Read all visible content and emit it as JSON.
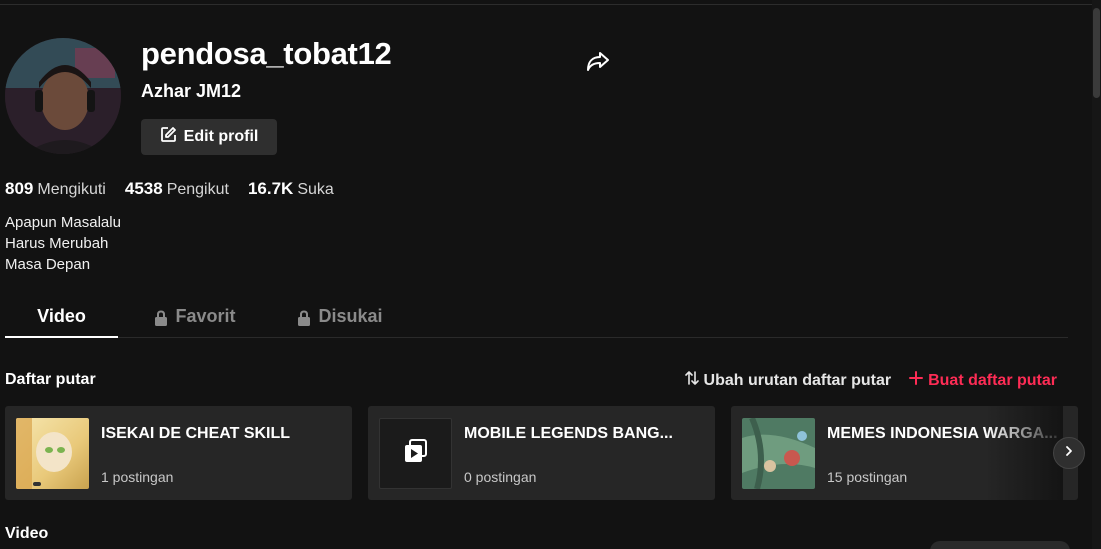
{
  "profile": {
    "username": "pendosa_tobat12",
    "nickname": "Azhar JM12",
    "edit_label": "Edit profil",
    "bio": "Apapun Masalalu\nHarus Merubah\nMasa Depan"
  },
  "stats": [
    {
      "value": "809",
      "label": "Mengikuti"
    },
    {
      "value": "4538",
      "label": "Pengikut"
    },
    {
      "value": "16.7K",
      "label": "Suka"
    }
  ],
  "tabs": [
    {
      "label": "Video",
      "locked": false,
      "active": true
    },
    {
      "label": "Favorit",
      "locked": true,
      "active": false
    },
    {
      "label": "Disukai",
      "locked": true,
      "active": false
    }
  ],
  "playlists": {
    "title": "Daftar putar",
    "sort_label": "Ubah urutan daftar putar",
    "create_label": "Buat daftar putar",
    "items": [
      {
        "title": "ISEKAI DE CHEAT SKILL",
        "count": "1 postingan"
      },
      {
        "title": "MOBILE LEGENDS BANG...",
        "count": "0 postingan"
      },
      {
        "title": "MEMES INDONESIA WARGA...",
        "count": "15 postingan"
      }
    ]
  },
  "videos": {
    "title": "Video"
  },
  "colors": {
    "background": "#121212",
    "accent": "#fe2c55",
    "surface": "#262626",
    "muted": "#8a8a8a"
  }
}
